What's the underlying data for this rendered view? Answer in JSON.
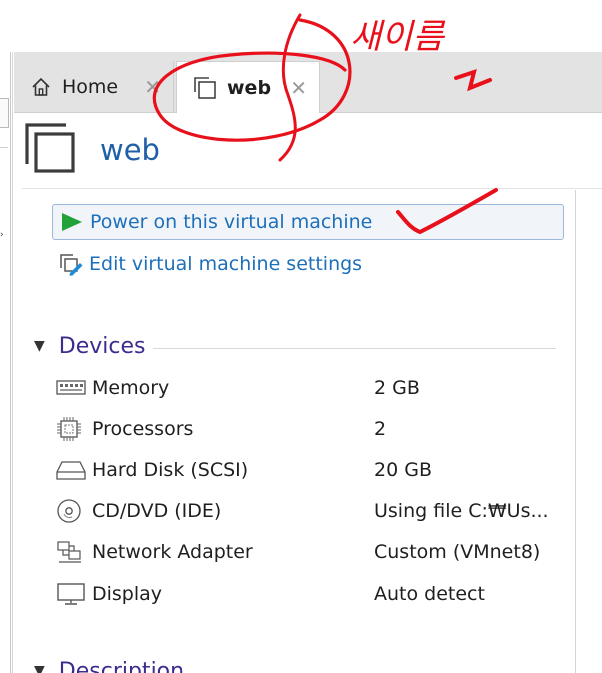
{
  "tabs": [
    {
      "label": "Home",
      "icon": "home-icon"
    },
    {
      "label": "web",
      "icon": "vm-icon"
    }
  ],
  "vm": {
    "title": "web"
  },
  "actions": {
    "power_on": "Power on this virtual machine",
    "edit_settings": "Edit virtual machine settings"
  },
  "devices": {
    "heading": "Devices",
    "items": [
      {
        "name": "Memory",
        "value": "2 GB",
        "icon": "memory-icon"
      },
      {
        "name": "Processors",
        "value": "2",
        "icon": "processor-icon"
      },
      {
        "name": "Hard Disk (SCSI)",
        "value": "20 GB",
        "icon": "hard-disk-icon"
      },
      {
        "name": "CD/DVD (IDE)",
        "value": "Using file C:₩Us...",
        "icon": "cd-dvd-icon"
      },
      {
        "name": "Network Adapter",
        "value": "Custom (VMnet8)",
        "icon": "network-adapter-icon"
      },
      {
        "name": "Display",
        "value": "Auto detect",
        "icon": "display-icon"
      }
    ]
  },
  "description": {
    "heading": "Description"
  },
  "annotation": {
    "handwritten_text": "새이름",
    "color": "#e8101a"
  },
  "colors": {
    "link": "#1e6fba",
    "title": "#1e5fa8",
    "section": "#3e2b8e",
    "power_green": "#23a23a",
    "tabbar": "#e3e3e3"
  }
}
